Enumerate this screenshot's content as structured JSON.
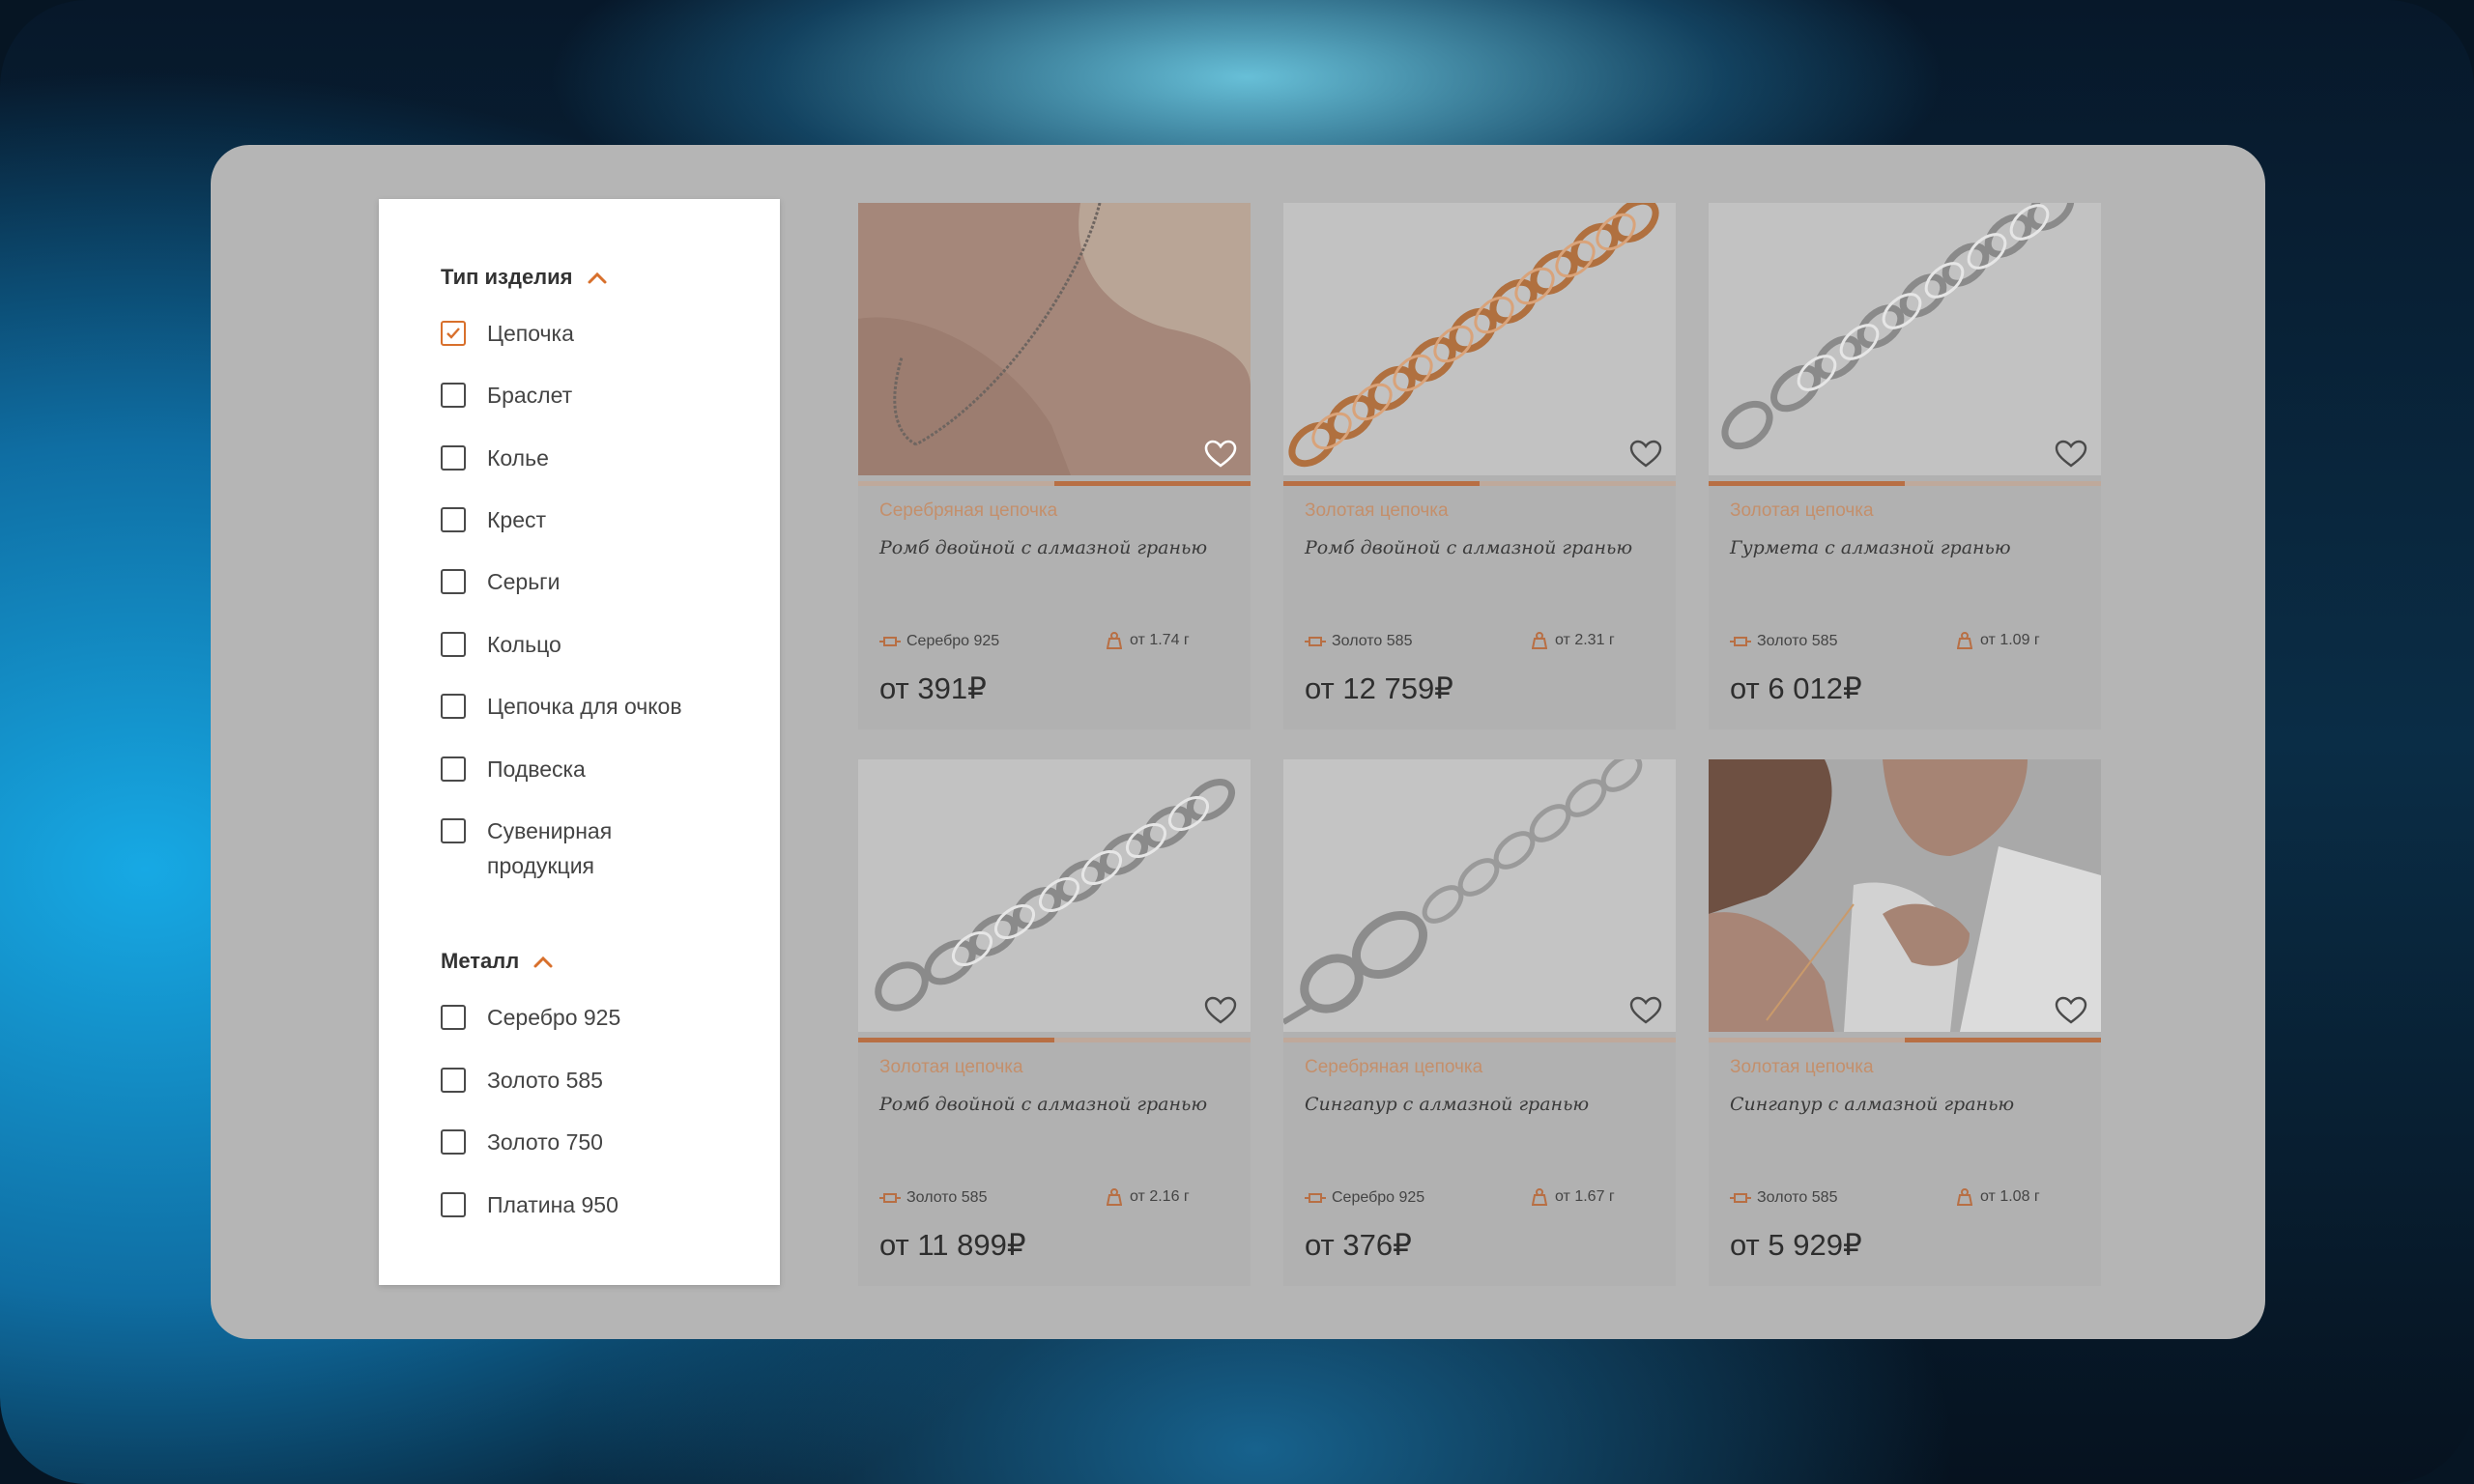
{
  "filters": {
    "type_group": {
      "title": "Тип изделия",
      "items": [
        {
          "label": "Цепочка",
          "checked": true
        },
        {
          "label": "Браслет",
          "checked": false
        },
        {
          "label": "Колье",
          "checked": false
        },
        {
          "label": "Крест",
          "checked": false
        },
        {
          "label": "Серьги",
          "checked": false
        },
        {
          "label": "Кольцо",
          "checked": false
        },
        {
          "label": "Цепочка для очков",
          "checked": false
        },
        {
          "label": "Подвеска",
          "checked": false
        },
        {
          "label": "Сувенирная продукция",
          "checked": false
        }
      ]
    },
    "metal_group": {
      "title": "Металл",
      "items": [
        {
          "label": "Серебро 925",
          "checked": false
        },
        {
          "label": "Золото 585",
          "checked": false
        },
        {
          "label": "Золото 750",
          "checked": false
        },
        {
          "label": "Платина 950",
          "checked": false
        }
      ]
    }
  },
  "products": [
    {
      "category": "Серебряная цепочка",
      "name": "Ромб двойной с алмазной гранью",
      "metal": "Серебро 925",
      "weight": "от 1.74 г",
      "price": "от 391₽",
      "image_icon": "neck-chain-photo",
      "progress": 0.5
    },
    {
      "category": "Золотая цепочка",
      "name": "Ромб двойной с алмазной гранью",
      "metal": "Золото 585",
      "weight": "от 2.31 г",
      "price": "от 12 759₽",
      "image_icon": "gold-chain-photo",
      "progress": 0.5
    },
    {
      "category": "Золотая цепочка",
      "name": "Гурмета с алмазной гранью",
      "metal": "Золото 585",
      "weight": "от 1.09 г",
      "price": "от 6 012₽",
      "image_icon": "white-gold-chain-photo",
      "progress": 0.5
    },
    {
      "category": "Золотая цепочка",
      "name": "Ромб двойной с алмазной гранью",
      "metal": "Золото 585",
      "weight": "от 2.16 г",
      "price": "от 11 899₽",
      "image_icon": "white-gold-chain-photo",
      "progress": 0.5
    },
    {
      "category": "Серебряная цепочка",
      "name": "Сингапур с алмазной гранью",
      "metal": "Серебро 925",
      "weight": "от 1.67 г",
      "price": "от 376₽",
      "image_icon": "silver-chain-photo",
      "progress": 0
    },
    {
      "category": "Золотая цепочка",
      "name": "Сингапур с алмазной гранью",
      "metal": "Золото 585",
      "weight": "от 1.08 г",
      "price": "от 5 929₽",
      "image_icon": "model-photo",
      "progress": 0.5
    }
  ],
  "colors": {
    "accent": "#d8702c",
    "panel": "#b5b5b5",
    "progress_fill": "#b86f44"
  }
}
